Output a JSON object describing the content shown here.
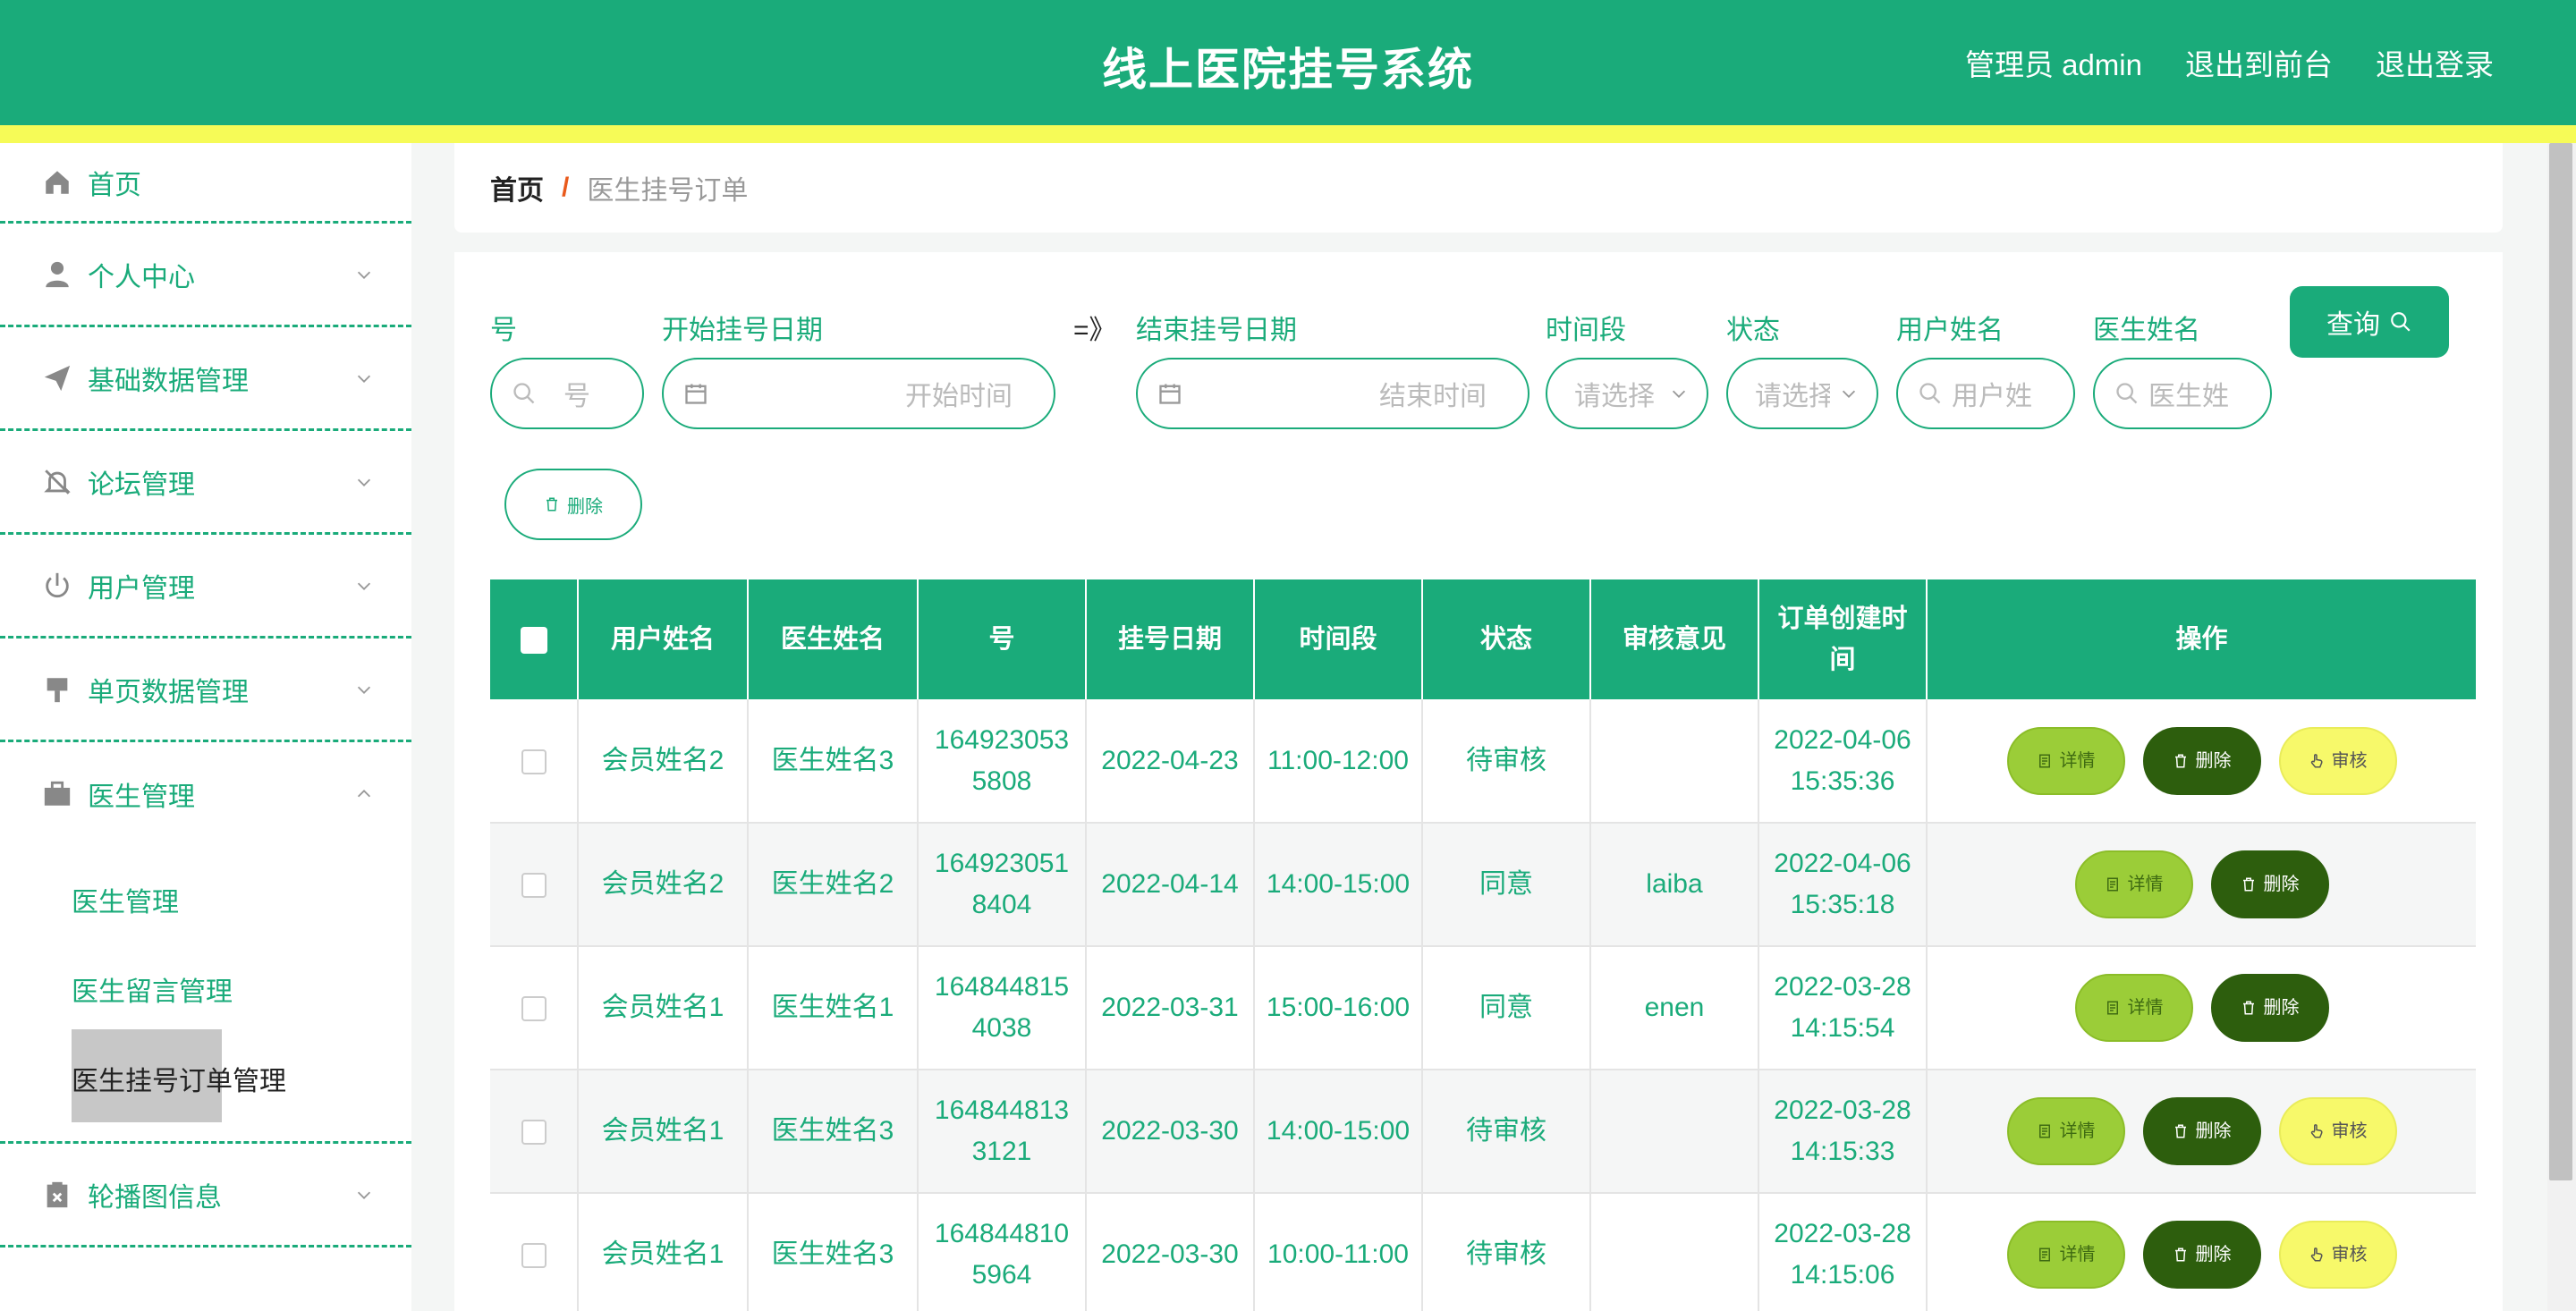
{
  "header": {
    "title": "线上医院挂号系统",
    "admin": "管理员 admin",
    "to_front": "退出到前台",
    "logout": "退出登录"
  },
  "sidebar": {
    "items": [
      {
        "label": "首页",
        "icon": "home-icon"
      },
      {
        "label": "个人中心",
        "icon": "user-icon"
      },
      {
        "label": "基础数据管理",
        "icon": "send-icon"
      },
      {
        "label": "论坛管理",
        "icon": "bell-off-icon"
      },
      {
        "label": "用户管理",
        "icon": "power-icon"
      },
      {
        "label": "单页数据管理",
        "icon": "brush-icon"
      },
      {
        "label": "医生管理",
        "icon": "briefcase-icon"
      }
    ],
    "sub_items": [
      {
        "label": "医生管理"
      },
      {
        "label": "医生留言管理"
      },
      {
        "label": "医生挂号订单管理"
      }
    ],
    "last_item": {
      "label": "轮播图信息",
      "icon": "clipboard-icon"
    }
  },
  "breadcrumb": {
    "home": "首页",
    "separator": "/",
    "current": "医生挂号订单"
  },
  "filters": {
    "number_label": "号",
    "number_placeholder": "号",
    "start_label": "开始挂号日期",
    "start_placeholder": "开始时间",
    "range_sep": "=》",
    "end_label": "结束挂号日期",
    "end_placeholder": "结束时间",
    "period_label": "时间段",
    "period_placeholder": "请选择",
    "status_label": "状态",
    "status_placeholder": "请选择",
    "user_label": "用户姓名",
    "user_placeholder": "用户姓名",
    "doctor_label": "医生姓名",
    "doctor_placeholder": "医生姓名",
    "query": "查询",
    "delete": "删除"
  },
  "table": {
    "columns": [
      "用户姓名",
      "医生姓名",
      "号",
      "挂号日期",
      "时间段",
      "状态",
      "审核意见",
      "订单创建时间",
      "操作"
    ],
    "rows": [
      {
        "user": "会员姓名2",
        "doctor": "医生姓名3",
        "number": "1649230535808",
        "date": "2022-04-23",
        "period": "11:00-12:00",
        "status": "待审核",
        "opinion": "",
        "created": "2022-04-06 15:35:36",
        "can_audit": true
      },
      {
        "user": "会员姓名2",
        "doctor": "医生姓名2",
        "number": "1649230518404",
        "date": "2022-04-14",
        "period": "14:00-15:00",
        "status": "同意",
        "opinion": "laiba",
        "created": "2022-04-06 15:35:18",
        "can_audit": false
      },
      {
        "user": "会员姓名1",
        "doctor": "医生姓名1",
        "number": "1648448154038",
        "date": "2022-03-31",
        "period": "15:00-16:00",
        "status": "同意",
        "opinion": "enen",
        "created": "2022-03-28 14:15:54",
        "can_audit": false
      },
      {
        "user": "会员姓名1",
        "doctor": "医生姓名3",
        "number": "1648448133121",
        "date": "2022-03-30",
        "period": "14:00-15:00",
        "status": "待审核",
        "opinion": "",
        "created": "2022-03-28 14:15:33",
        "can_audit": true
      },
      {
        "user": "会员姓名1",
        "doctor": "医生姓名3",
        "number": "1648448105964",
        "date": "2022-03-30",
        "period": "10:00-11:00",
        "status": "待审核",
        "opinion": "",
        "created": "2022-03-28 14:15:06",
        "can_audit": true
      }
    ],
    "op_labels": {
      "detail": "详情",
      "delete": "删除",
      "audit": "审核"
    }
  },
  "colors": {
    "primary": "#1aab7a",
    "stripe": "#f6fb57",
    "detail": "#9bcd38",
    "delete": "#2d5e0d",
    "audit": "#f7f96a"
  }
}
